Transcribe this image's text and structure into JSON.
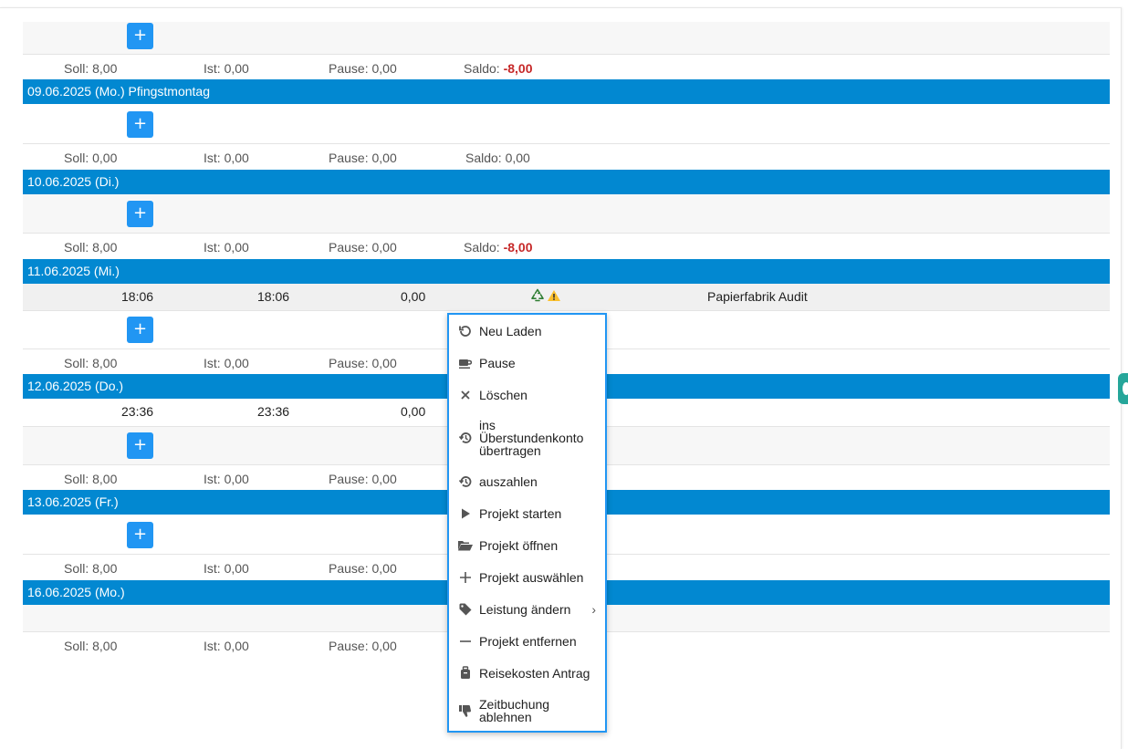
{
  "summary_labels": {
    "soll": "Soll:",
    "ist": "Ist:",
    "pause": "Pause:",
    "saldo": "Saldo:"
  },
  "add_button": "+",
  "groups": [
    {
      "soll": "8,00",
      "ist": "0,00",
      "pause": "0,00",
      "saldo": "-8,00"
    },
    {
      "day": "09.06.2025 (Mo.) Pfingstmontag",
      "soll": "0,00",
      "ist": "0,00",
      "pause": "0,00",
      "saldo": "0,00"
    },
    {
      "day": "10.06.2025 (Di.)",
      "soll": "8,00",
      "ist": "0,00",
      "pause": "0,00",
      "saldo": "-8,00"
    },
    {
      "day": "11.06.2025 (Mi.)",
      "entry": {
        "start": "18:06",
        "end": "18:06",
        "duration": "0,00",
        "project": "Papierfabrik Audit",
        "icons": [
          "recycle-icon",
          "warning-icon"
        ]
      },
      "soll": "8,00",
      "ist": "0,00",
      "pause": "0,00"
    },
    {
      "day": "12.06.2025 (Do.)",
      "entry": {
        "start": "23:36",
        "end": "23:36",
        "duration": "0,00"
      },
      "soll": "8,00",
      "ist": "0,00",
      "pause": "0,00"
    },
    {
      "day": "13.06.2025 (Fr.)",
      "soll": "8,00",
      "ist": "0,00",
      "pause": "0,00"
    },
    {
      "day": "16.06.2025 (Mo.)",
      "soll": "8,00",
      "ist": "0,00",
      "pause": "0,00"
    }
  ],
  "context_menu": [
    {
      "label": "Neu Laden",
      "icon": "refresh-icon"
    },
    {
      "label": "Pause",
      "icon": "coffee-icon"
    },
    {
      "label": "Löschen",
      "icon": "close-icon"
    },
    {
      "label": "ins Überstundenkonto übertragen",
      "icon": "history-icon"
    },
    {
      "label": "auszahlen",
      "icon": "history-icon"
    },
    {
      "label": "Projekt starten",
      "icon": "play-icon"
    },
    {
      "label": "Projekt öffnen",
      "icon": "folder-open-icon"
    },
    {
      "label": "Projekt auswählen",
      "icon": "plus-icon"
    },
    {
      "label": "Leistung ändern",
      "icon": "tag-icon",
      "submenu": "›"
    },
    {
      "label": "Projekt entfernen",
      "icon": "minus-icon"
    },
    {
      "label": "Reisekosten Antrag",
      "icon": "briefcase-icon"
    },
    {
      "label": "Zeitbuchung ablehnen",
      "icon": "thumbs-down-icon"
    }
  ],
  "colors": {
    "day_header": "#0288d1",
    "add_button": "#2196f3",
    "negative": "#c62828",
    "menu_border": "#2196f3",
    "recycle": "#2e7d32",
    "warning": "#fbc02d"
  }
}
